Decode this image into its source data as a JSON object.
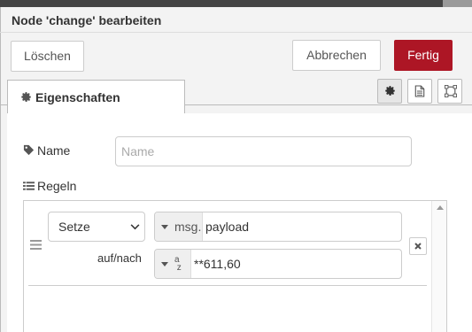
{
  "dialog": {
    "title": "Node 'change' bearbeiten"
  },
  "toolbar": {
    "delete_label": "Löschen",
    "cancel_label": "Abbrechen",
    "done_label": "Fertig"
  },
  "tabs": {
    "properties_label": "Eigenschaften"
  },
  "form": {
    "name_label": "Name",
    "name_placeholder": "Name",
    "rules_label": "Regeln"
  },
  "rule": {
    "operation": "Setze",
    "property_type": "msg.",
    "property_value": "payload",
    "to_label": "auf/nach",
    "value_type_glyph_top": "a",
    "value_type_glyph_bottom": "z",
    "value": "**611,60"
  },
  "colors": {
    "primary_button": "#ad1625",
    "tray_background": "#f3f3f3",
    "border": "#cccccc"
  },
  "icons": [
    "cog-icon",
    "tag-icon",
    "list-icon",
    "file-text-icon",
    "window-icon",
    "drag-handle-icon",
    "caret-down-icon",
    "chevron-down-icon",
    "remove-icon"
  ]
}
